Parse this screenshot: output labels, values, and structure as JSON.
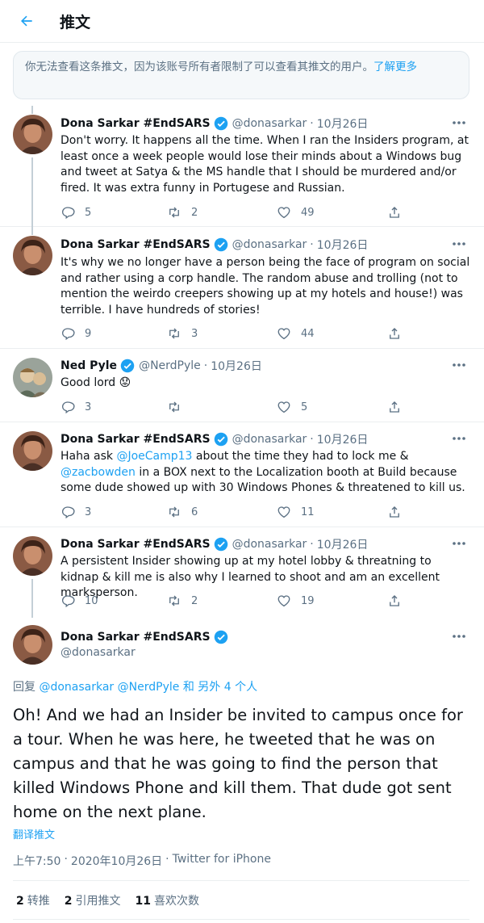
{
  "header": {
    "title": "推文"
  },
  "notice": {
    "text": "你无法查看这条推文，因为该账号所有者限制了可以查看其推文的用户。",
    "link": "了解更多"
  },
  "tweets": [
    {
      "name": "Dona Sarkar #EndSARS",
      "handle": "@donasarkar",
      "sep": "·",
      "date": "10月26日",
      "text": "Don't worry. It happens all the time. When I ran the Insiders program, at least once a week people would lose their minds about a Windows bug and tweet at Satya & the MS handle that I should be murdered and/or fired. It was extra funny in Portugese and Russian.",
      "replies": "5",
      "retweets": "2",
      "likes": "49"
    },
    {
      "name": "Dona Sarkar #EndSARS",
      "handle": "@donasarkar",
      "sep": "·",
      "date": "10月26日",
      "text": "It's why we no longer have a person being the face of program on social and rather using a corp handle. The random abuse and trolling (not to mention the weirdo creepers showing up at my hotels and house!) was terrible. I have hundreds of stories!",
      "replies": "9",
      "retweets": "3",
      "likes": "44"
    },
    {
      "name": "Ned Pyle",
      "handle": "@NerdPyle",
      "sep": "·",
      "date": "10月26日",
      "text": "Good lord",
      "emoji": "😟",
      "replies": "3",
      "retweets": "",
      "likes": "5"
    },
    {
      "name": "Dona Sarkar #EndSARS",
      "handle": "@donasarkar",
      "sep": "·",
      "date": "10月26日",
      "text_a": "Haha ask ",
      "mention_a": "@JoeCamp13",
      "text_b": " about the time they had to lock me & ",
      "mention_b": "@zacbowden",
      "text_c": " in a BOX next to the Localization booth at Build because some dude showed up with 30 Windows Phones & threatened to kill us.",
      "replies": "3",
      "retweets": "6",
      "likes": "11"
    },
    {
      "name": "Dona Sarkar #EndSARS",
      "handle": "@donasarkar",
      "sep": "·",
      "date": "10月26日",
      "text": "A persistent Insider showing up at my hotel lobby & threatning to kidnap & kill me is also why I learned to shoot and am an excellent marksperson.",
      "replies": "10",
      "retweets": "2",
      "likes": "19"
    }
  ],
  "main_tweet": {
    "name": "Dona Sarkar #EndSARS",
    "handle": "@donasarkar",
    "reply_prefix": "回复",
    "reply_mention_1": "@donasarkar",
    "reply_mention_2": "@NerdPyle",
    "reply_suffix": "和 另外 4 个人",
    "text": "Oh! And we had an Insider be invited to campus once for a tour. When he was here, he tweeted that he was on campus and that he was going to find the person that killed Windows Phone and kill them. That dude got sent home on the next plane.",
    "translate": "翻译推文",
    "time": "上午7:50",
    "sep": "·",
    "date": "2020年10月26日",
    "client": "Twitter for iPhone",
    "stats": {
      "retweets": "2",
      "retweets_label": "转推",
      "quotes": "2",
      "quotes_label": "引用推文",
      "likes": "11",
      "likes_label": "喜欢次数"
    }
  },
  "colors": {
    "accent": "#1da1f2",
    "muted": "#5b7083",
    "text": "#0f1419",
    "border": "#ebeef0"
  },
  "icons": [
    "back-arrow-icon",
    "verified-badge-icon",
    "more-icon",
    "reply-icon",
    "retweet-icon",
    "like-icon",
    "share-icon"
  ]
}
